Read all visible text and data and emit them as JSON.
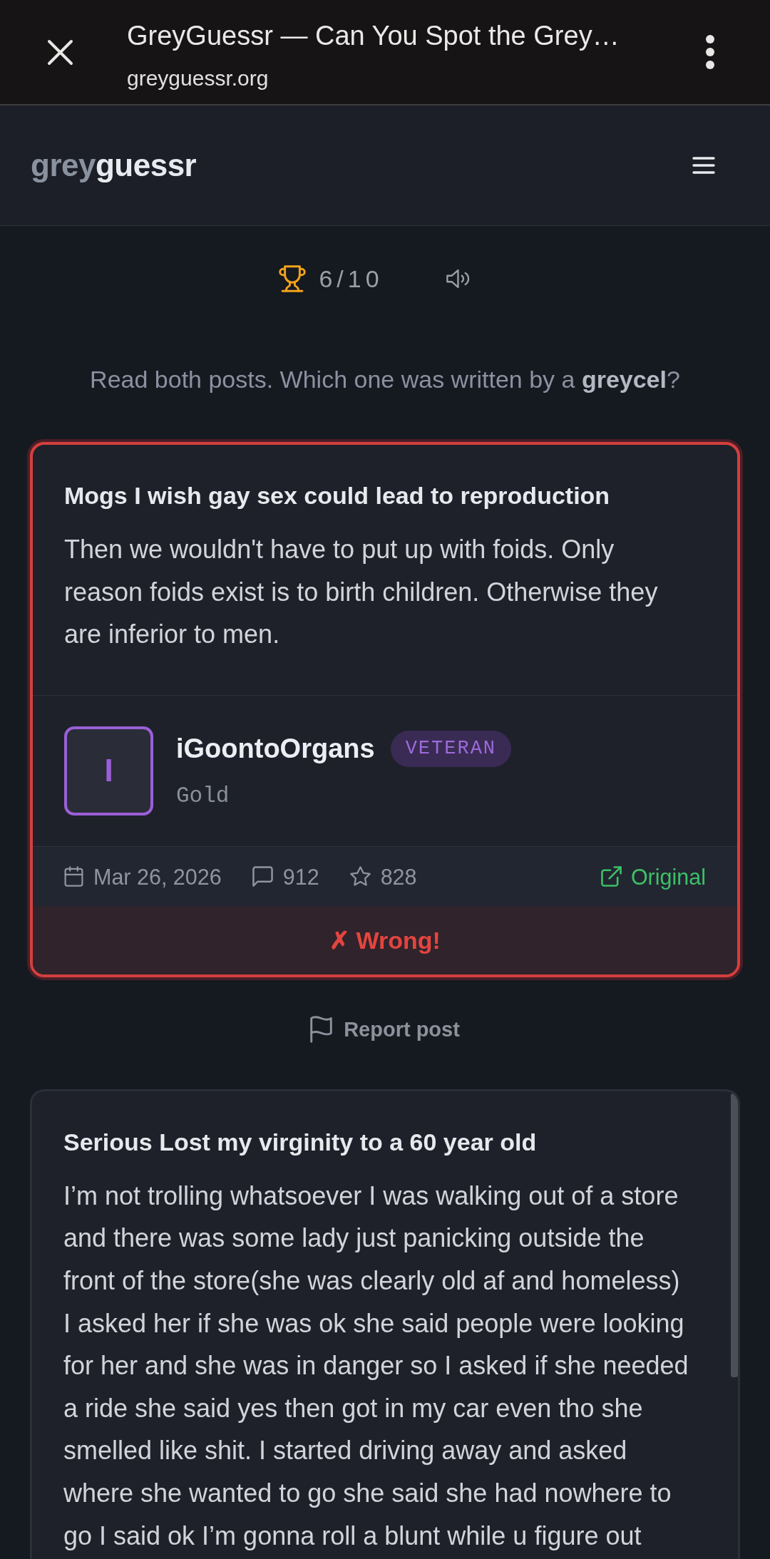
{
  "browser_bar": {
    "title": "GreyGuessr — Can You Spot the Grey…",
    "url": "greyguessr.org"
  },
  "site_header": {
    "logo_part_1": "grey",
    "logo_part_2": "guessr"
  },
  "score_bar": {
    "score": "6/10",
    "sound_muted": false
  },
  "prompt": "Read both posts. Which one was written by a **greycel**?",
  "posts": [
    {
      "selected": true,
      "title": "Mogs I wish gay sex could lead to reproduction",
      "body": "Then we wouldn't have to put up with foids. Only reason foids exist is to birth children. Otherwise they are inferior to men.",
      "author": {
        "initial": "I",
        "name": "iGoontoOrgans",
        "badge": "VETERAN",
        "rank": "Gold"
      },
      "meta": {
        "date": "Mar 26, 2026",
        "comments": "912",
        "favorites": "828",
        "link": "Original"
      },
      "result": {
        "kind": "wrong",
        "label": "✗ Wrong!"
      },
      "report": "Report post"
    },
    {
      "selected": false,
      "title": "Serious Lost my virginity to a 60 year old",
      "body": "I’m not trolling whatsoever I was walking out of a store and there was some lady just panicking outside the front of the store(she was clearly old af and homeless) I asked her if she was ok she said people were looking for her and she was in danger so I asked if she needed a ride she said yes then got in my car even tho she smelled like shit. I started driving away and asked where she wanted to go she said she had nowhere to go I said ok I’m gonna roll a blunt while u figure out"
    }
  ]
}
